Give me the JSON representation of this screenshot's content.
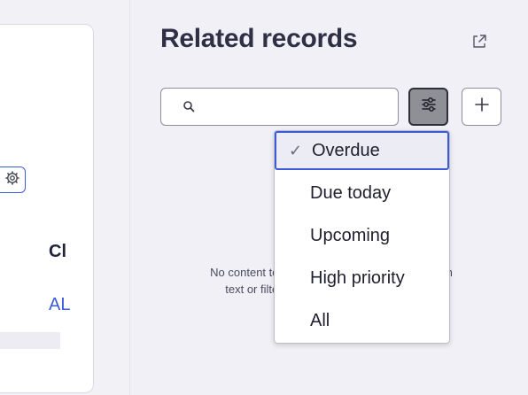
{
  "left_panel": {
    "heading": "Cl",
    "link": "AL"
  },
  "related_records": {
    "title": "Related records",
    "search": {
      "value": "",
      "placeholder": ""
    },
    "empty_message": {
      "line1": "No content to display. Try changing your search",
      "line2": "text or filter to find what you're looking for."
    },
    "filter_menu": {
      "items": [
        {
          "label": "Overdue",
          "selected": true
        },
        {
          "label": "Due today",
          "selected": false
        },
        {
          "label": "Upcoming",
          "selected": false
        },
        {
          "label": "High priority",
          "selected": false
        },
        {
          "label": "All",
          "selected": false
        }
      ]
    }
  },
  "icons": {
    "gear": "gear-icon",
    "external": "external-link-icon",
    "search": "search-icon",
    "filter": "sliders-icon",
    "add": "plus-icon",
    "check": "check-icon"
  },
  "colors": {
    "accent": "#3d5bd9",
    "panel_background": "#f0f0f6",
    "filter_button_active": "#8f8f96"
  }
}
